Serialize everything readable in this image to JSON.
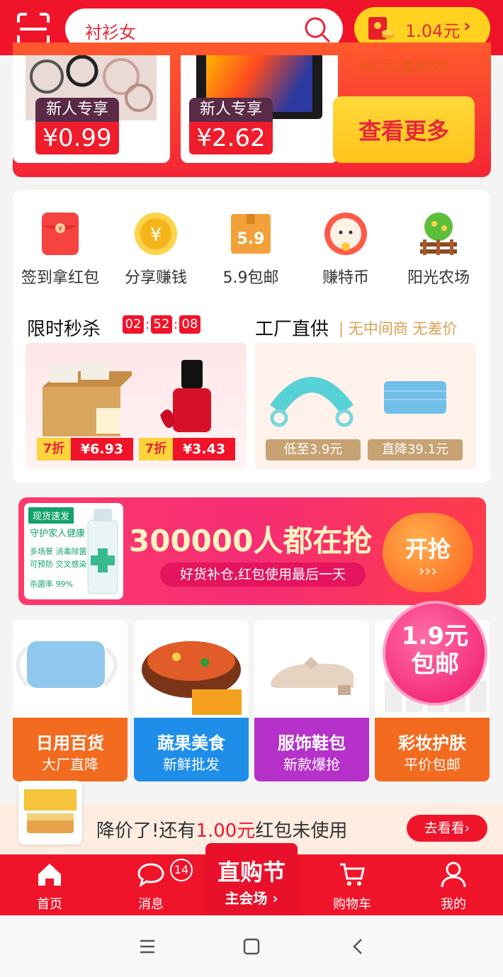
{
  "search": {
    "query": "衬衫女"
  },
  "wallet": {
    "amount": "1.04元",
    "arrow": "›"
  },
  "promo": {
    "items": [
      {
        "tag": "新人专享",
        "price": "¥0.99"
      },
      {
        "tag": "新人专享",
        "price": "¥2.62"
      }
    ],
    "coupon_text": "专场通用券",
    "more_label": "查看更多"
  },
  "quick": [
    {
      "label": "签到拿红包",
      "icon": "red-envelope-icon"
    },
    {
      "label": "分享赚钱",
      "icon": "yen-coin-icon"
    },
    {
      "label": "5.9包邮",
      "icon": "box-59-icon"
    },
    {
      "label": "赚特币",
      "icon": "lucky-cat-icon"
    },
    {
      "label": "阳光农场",
      "icon": "farm-tree-icon"
    }
  ],
  "flash": {
    "title": "限时秒杀",
    "timer": [
      "02",
      "52",
      "08"
    ],
    "deals": [
      {
        "discount": "7折",
        "price": "¥6.93"
      },
      {
        "discount": "7折",
        "price": "¥3.43"
      }
    ]
  },
  "factory": {
    "title": "工厂直供",
    "subtitle": "| 无中间商 无差价",
    "chips": [
      "低至3.9元",
      "直降39.1元"
    ]
  },
  "banner": {
    "tag": "现货速发",
    "line1": "守护家人健康",
    "line2": "多场景 消毒除菌",
    "line3": "可预防 交叉感染",
    "line4": "杀菌率 99%",
    "headline": "300000人都在抢",
    "sub": "好货补仓,红包使用最后一天",
    "cta": "开抢",
    "cta_arrows": "›››"
  },
  "categories": [
    {
      "title": "日用百货",
      "sub": "大厂直降",
      "color": "#f36b1f"
    },
    {
      "title": "蔬果美食",
      "sub": "新鲜批发",
      "color": "#1e8ee8"
    },
    {
      "title": "服饰鞋包",
      "sub": "新款爆抢",
      "color": "#b531c9"
    },
    {
      "title": "彩妆护肤",
      "sub": "平价包邮",
      "color": "#f36b1f"
    }
  ],
  "badge": {
    "line1": "1.9元",
    "line2": "包邮"
  },
  "notice": {
    "prefix": "降价了!还有",
    "amount": "1.00元",
    "suffix": "红包未使用",
    "button": "去看看›"
  },
  "tabs": {
    "home": "首页",
    "messages": "消息",
    "messages_count": "14",
    "center_title": "直购节",
    "center_sub": "主会场 ›",
    "cart": "购物车",
    "me": "我的"
  },
  "colors": {
    "brand": "#f0142a",
    "gold": "#ffd21f"
  }
}
